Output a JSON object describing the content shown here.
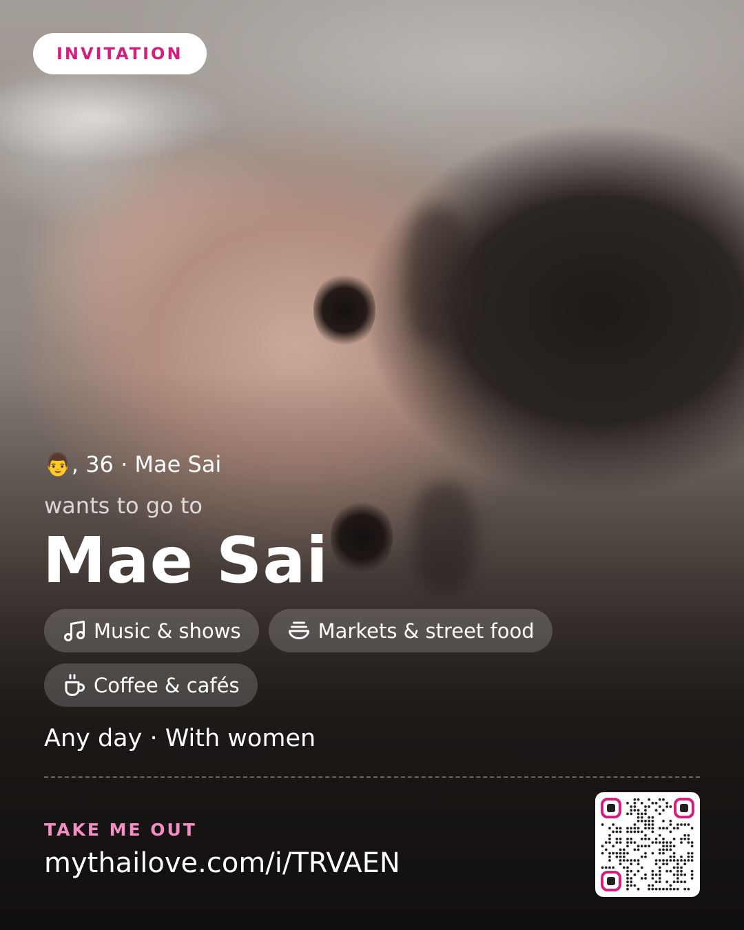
{
  "badge": {
    "label": "INVITATION"
  },
  "profile": {
    "meta": "👨, 36 · Mae Sai",
    "wants": "wants to go to",
    "destination": "Mae Sai"
  },
  "chips": [
    {
      "icon": "music-note-icon",
      "label": "Music & shows"
    },
    {
      "icon": "food-bowl-icon",
      "label": "Markets & street food"
    },
    {
      "icon": "coffee-cup-icon",
      "label": "Coffee & cafés"
    }
  ],
  "when": "Any day · With women",
  "cta": {
    "label": "TAKE ME OUT",
    "url": "mythailove.com/i/TRVAEN"
  },
  "qr": {
    "icon": "qr-code-icon"
  },
  "colors": {
    "accent": "#d21e7d",
    "accent_light": "#f48fc5"
  }
}
